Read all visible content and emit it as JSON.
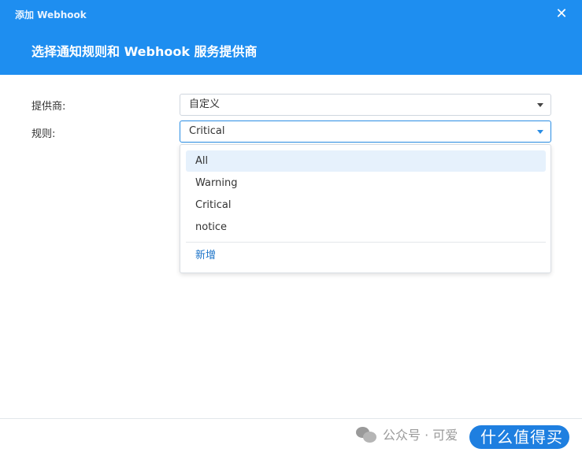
{
  "window": {
    "title": "添加 Webhook",
    "heading": "选择通知规则和 Webhook 服务提供商"
  },
  "form": {
    "provider_label": "提供商:",
    "provider_value": "自定义",
    "rule_label": "规则:",
    "rule_value": "Critical"
  },
  "dropdown": {
    "options": [
      "All",
      "Warning",
      "Critical",
      "notice"
    ],
    "highlighted": "All",
    "add_label": "新增"
  },
  "watermark": {
    "prefix": "公众号 · 可爱",
    "badge": "什么值得买"
  },
  "colors": {
    "header_bg": "#1e8ef0",
    "accent": "#2a8de4",
    "link": "#1b73c8"
  }
}
